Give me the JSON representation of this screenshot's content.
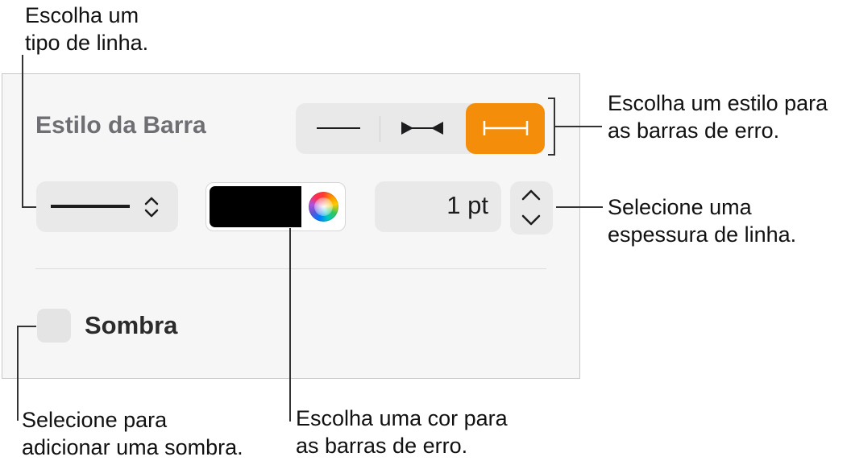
{
  "callouts": {
    "line_type": "Escolha um\ntipo de linha.",
    "bar_style": "Escolha um estilo para\nas barras de erro.",
    "line_width": "Selecione uma\nespessura de linha.",
    "shadow": "Selecione para\nadicionar uma sombra.",
    "color": "Escolha uma cor para\nas barras de erro."
  },
  "panel": {
    "section_title": "Estilo da Barra",
    "bar_style_options": [
      "line",
      "line-with-end-arrows",
      "line-with-end-caps"
    ],
    "selected_bar_style": "line-with-end-caps",
    "line_style": "solid",
    "color": {
      "swatch": "#000000"
    },
    "width": {
      "value": "1 pt"
    },
    "shadow": {
      "label": "Sombra",
      "checked": false
    }
  },
  "colors": {
    "accent": "#f48e0a",
    "control_bg": "#e9e9e9",
    "panel_bg": "#f6f6f6"
  }
}
